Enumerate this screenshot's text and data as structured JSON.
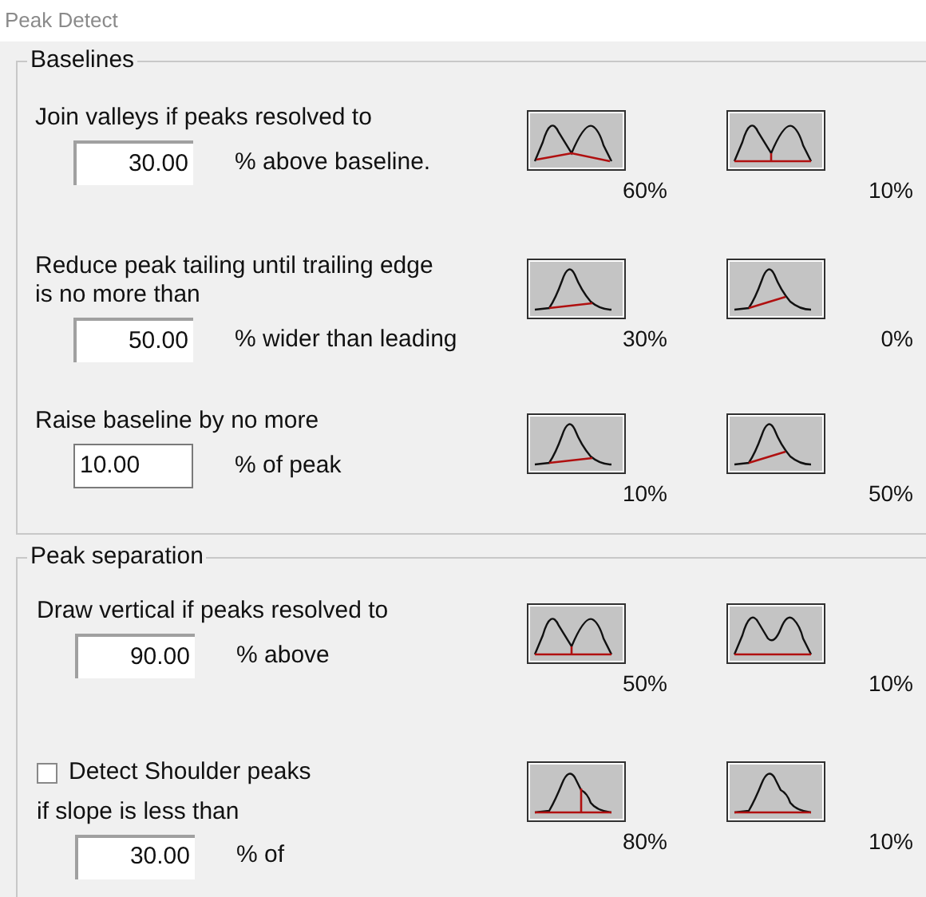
{
  "window": {
    "title": "Peak Detect"
  },
  "groups": [
    {
      "title": "Baselines",
      "rows": [
        {
          "label_lines": [
            "Join valleys if peaks resolved to"
          ],
          "value": "30.00",
          "focused": false,
          "suffix": "% above baseline.",
          "examples": [
            {
              "kind": "join",
              "caption": "60%"
            },
            {
              "kind": "drop",
              "caption": "10%"
            }
          ]
        },
        {
          "label_lines": [
            "Reduce peak tailing until trailing edge",
            "is no more than"
          ],
          "value": "50.00",
          "focused": false,
          "suffix": "% wider than leading",
          "examples": [
            {
              "kind": "tail-low",
              "caption": "30%"
            },
            {
              "kind": "tail-high",
              "caption": "0%"
            }
          ]
        },
        {
          "label_lines": [
            "Raise baseline by no more"
          ],
          "value": "10.00",
          "focused": true,
          "suffix": "% of peak",
          "examples": [
            {
              "kind": "tail-low",
              "caption": "10%"
            },
            {
              "kind": "tail-high",
              "caption": "50%"
            }
          ]
        }
      ]
    },
    {
      "title": "Peak separation",
      "rows": [
        {
          "label_lines": [
            "Draw vertical if peaks resolved to"
          ],
          "value": "90.00",
          "focused": false,
          "suffix": "% above",
          "examples": [
            {
              "kind": "drop",
              "caption": "50%"
            },
            {
              "kind": "merge",
              "caption": "10%"
            }
          ]
        },
        {
          "checkbox": {
            "label": "Detect Shoulder peaks",
            "checked": false
          },
          "label_lines": [
            "if slope is less than"
          ],
          "value": "30.00",
          "focused": false,
          "suffix": "% of",
          "examples": [
            {
              "kind": "shoulder-drop",
              "caption": "80%"
            },
            {
              "kind": "shoulder-none",
              "caption": "10%"
            }
          ]
        }
      ]
    }
  ]
}
